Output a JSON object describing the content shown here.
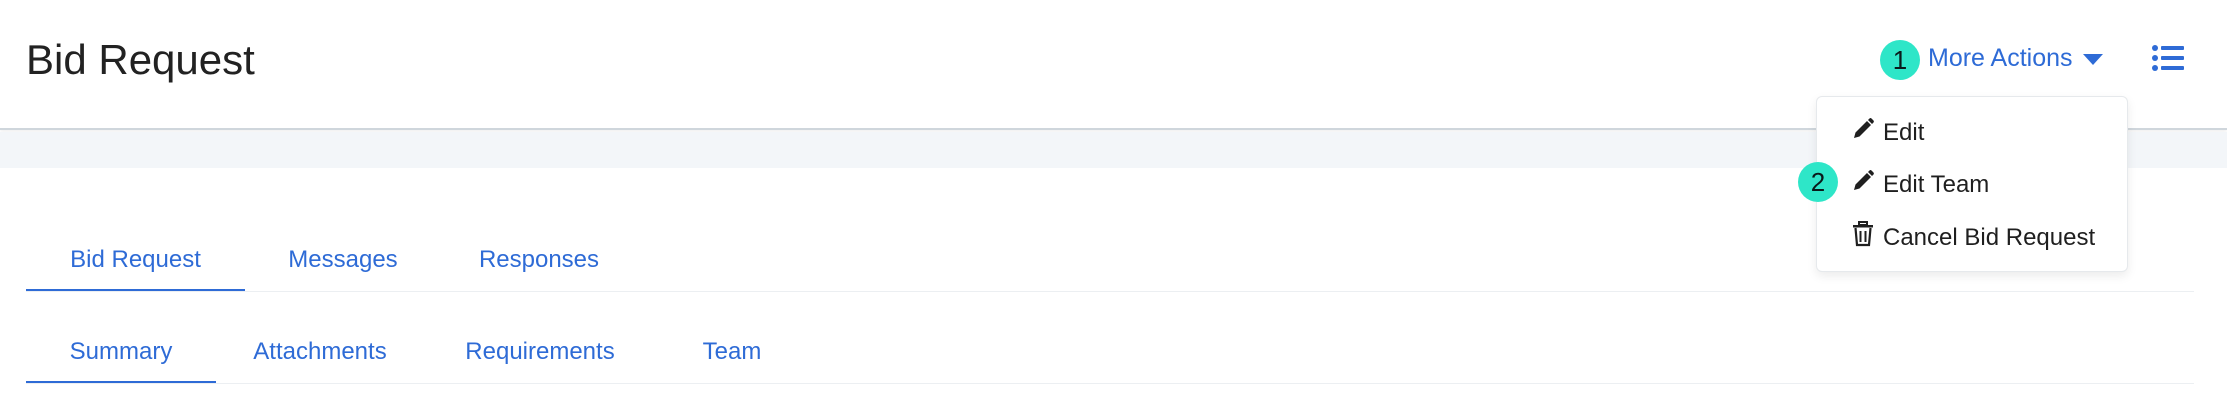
{
  "header": {
    "title": "Bid Request",
    "more_actions_label": "More Actions"
  },
  "markers": {
    "one": "1",
    "two": "2"
  },
  "more_actions_menu": {
    "items": [
      {
        "label": "Edit",
        "icon": "pencil-icon"
      },
      {
        "label": "Edit Team",
        "icon": "pencil-icon"
      },
      {
        "label": "Cancel Bid Request",
        "icon": "trash-icon"
      }
    ]
  },
  "primary_tabs": [
    {
      "label": "Bid Request",
      "active": true
    },
    {
      "label": "Messages",
      "active": false
    },
    {
      "label": "Responses",
      "active": false
    }
  ],
  "secondary_tabs": [
    {
      "label": "Summary",
      "active": true
    },
    {
      "label": "Attachments",
      "active": false
    },
    {
      "label": "Requirements",
      "active": false
    },
    {
      "label": "Team",
      "active": false
    }
  ],
  "colors": {
    "accent": "#2e6bd6",
    "marker": "#2ee6c8",
    "band": "#f3f6f9"
  },
  "icons": {
    "list": "list-icon",
    "caret": "caret-down-icon"
  }
}
